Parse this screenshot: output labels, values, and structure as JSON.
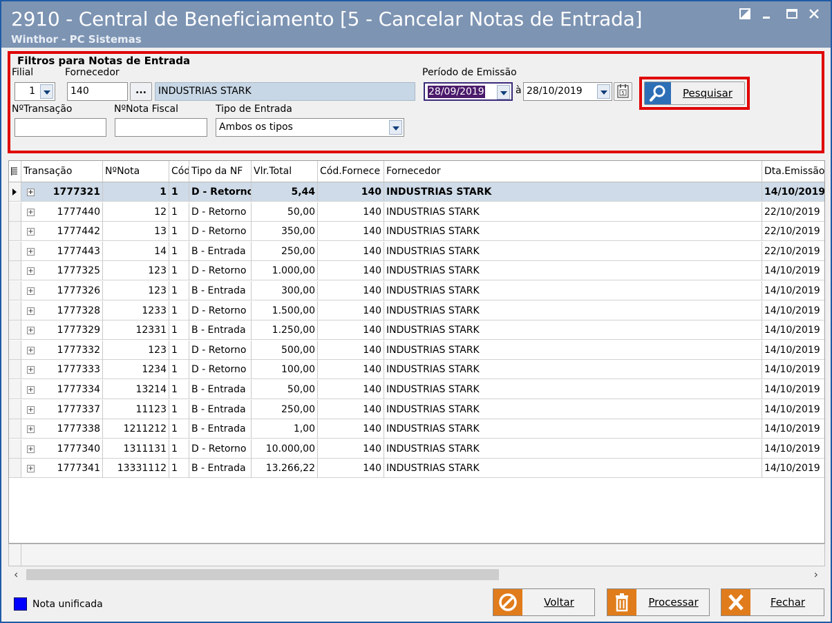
{
  "window": {
    "title": "2910 - Central de Beneficiamento [5 - Cancelar Notas de Entrada]",
    "subtitle": "Winthor - PC Sistemas"
  },
  "filters": {
    "group_title": "Filtros para Notas de Entrada",
    "filial_label": "Filial",
    "filial_value": "1",
    "fornecedor_label": "Fornecedor",
    "fornecedor_code": "140",
    "fornecedor_browse": "...",
    "fornecedor_name": "INDUSTRIAS STARK",
    "periodo_label": "Período de Emissão",
    "date_from": "28/09/2019",
    "date_sep": "à",
    "date_to": "28/10/2019",
    "transacao_label": "NºTransação",
    "transacao_value": "",
    "nota_label": "NºNota Fiscal",
    "nota_value": "",
    "tipo_label": "Tipo de Entrada",
    "tipo_value": "Ambos os tipos",
    "search_button": "Pesquisar"
  },
  "grid": {
    "columns": [
      "Transação",
      "NºNota",
      "Cód",
      "Tipo da NF",
      "Vlr.Total",
      "Cód.Fornece",
      "Fornecedor",
      "Dta.Emissão"
    ],
    "rows": [
      {
        "transacao": "1777321",
        "nota": "1",
        "cod": "1",
        "tipo": "D - Retorno",
        "valor": "5,44",
        "cod_forn": "140",
        "fornecedor": "INDUSTRIAS STARK",
        "emissao": "14/10/2019",
        "selected": true
      },
      {
        "transacao": "1777440",
        "nota": "12",
        "cod": "1",
        "tipo": "D - Retorno",
        "valor": "50,00",
        "cod_forn": "140",
        "fornecedor": "INDUSTRIAS STARK",
        "emissao": "22/10/2019"
      },
      {
        "transacao": "1777442",
        "nota": "13",
        "cod": "1",
        "tipo": "D - Retorno",
        "valor": "350,00",
        "cod_forn": "140",
        "fornecedor": "INDUSTRIAS STARK",
        "emissao": "22/10/2019"
      },
      {
        "transacao": "1777443",
        "nota": "14",
        "cod": "1",
        "tipo": "B - Entrada",
        "valor": "250,00",
        "cod_forn": "140",
        "fornecedor": "INDUSTRIAS STARK",
        "emissao": "22/10/2019"
      },
      {
        "transacao": "1777325",
        "nota": "123",
        "cod": "1",
        "tipo": "D - Retorno",
        "valor": "1.000,00",
        "cod_forn": "140",
        "fornecedor": "INDUSTRIAS STARK",
        "emissao": "14/10/2019"
      },
      {
        "transacao": "1777326",
        "nota": "123",
        "cod": "1",
        "tipo": "B - Entrada",
        "valor": "300,00",
        "cod_forn": "140",
        "fornecedor": "INDUSTRIAS STARK",
        "emissao": "14/10/2019"
      },
      {
        "transacao": "1777328",
        "nota": "1233",
        "cod": "1",
        "tipo": "D - Retorno",
        "valor": "1.500,00",
        "cod_forn": "140",
        "fornecedor": "INDUSTRIAS STARK",
        "emissao": "14/10/2019"
      },
      {
        "transacao": "1777329",
        "nota": "12331",
        "cod": "1",
        "tipo": "B - Entrada",
        "valor": "1.250,00",
        "cod_forn": "140",
        "fornecedor": "INDUSTRIAS STARK",
        "emissao": "14/10/2019"
      },
      {
        "transacao": "1777332",
        "nota": "123",
        "cod": "1",
        "tipo": "D - Retorno",
        "valor": "500,00",
        "cod_forn": "140",
        "fornecedor": "INDUSTRIAS STARK",
        "emissao": "14/10/2019"
      },
      {
        "transacao": "1777333",
        "nota": "1234",
        "cod": "1",
        "tipo": "D - Retorno",
        "valor": "100,00",
        "cod_forn": "140",
        "fornecedor": "INDUSTRIAS STARK",
        "emissao": "14/10/2019"
      },
      {
        "transacao": "1777334",
        "nota": "13214",
        "cod": "1",
        "tipo": "B - Entrada",
        "valor": "50,00",
        "cod_forn": "140",
        "fornecedor": "INDUSTRIAS STARK",
        "emissao": "14/10/2019"
      },
      {
        "transacao": "1777337",
        "nota": "11123",
        "cod": "1",
        "tipo": "B - Entrada",
        "valor": "250,00",
        "cod_forn": "140",
        "fornecedor": "INDUSTRIAS STARK",
        "emissao": "14/10/2019"
      },
      {
        "transacao": "1777338",
        "nota": "1211212",
        "cod": "1",
        "tipo": "B - Entrada",
        "valor": "1,00",
        "cod_forn": "140",
        "fornecedor": "INDUSTRIAS STARK",
        "emissao": "14/10/2019"
      },
      {
        "transacao": "1777340",
        "nota": "1311131",
        "cod": "1",
        "tipo": "D - Retorno",
        "valor": "10.000,00",
        "cod_forn": "140",
        "fornecedor": "INDUSTRIAS STARK",
        "emissao": "14/10/2019"
      },
      {
        "transacao": "1777341",
        "nota": "13331112",
        "cod": "1",
        "tipo": "B - Entrada",
        "valor": "13.266,22",
        "cod_forn": "140",
        "fornecedor": "INDUSTRIAS STARK",
        "emissao": "14/10/2019"
      }
    ]
  },
  "legend": {
    "label": "Nota unificada",
    "color": "#0000ff"
  },
  "buttons": {
    "voltar": "Voltar",
    "processar": "Processar",
    "fechar": "Fechar"
  },
  "colors": {
    "title_bar": "#7d94b3",
    "highlight_red": "#e00000",
    "selected_row": "#cfdbe8",
    "button_orange": "#e07c1b",
    "date_selected": "#4b1a6b"
  }
}
